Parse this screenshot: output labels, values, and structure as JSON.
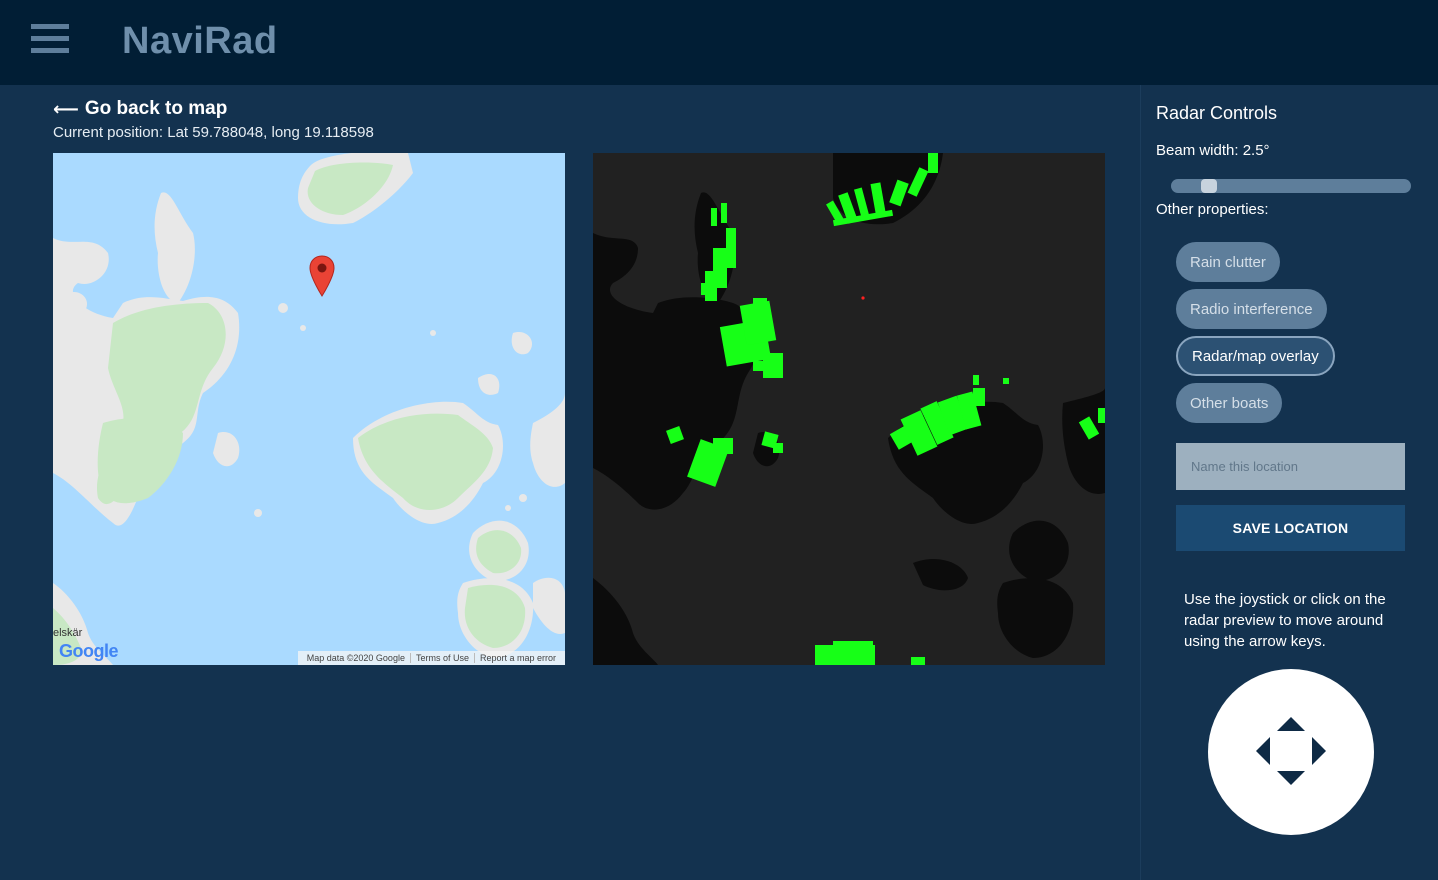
{
  "app": {
    "title": "NaviRad"
  },
  "header": {
    "menu_icon": "hamburger-menu-icon"
  },
  "main": {
    "back_arrow": "⟵",
    "back_label": "Go back to map",
    "position_text": "Current position: Lat 59.788048, long 19.118598",
    "map": {
      "place_label": "elskär",
      "google_logo": "Google",
      "credits": [
        "Map data ©2020 Google",
        "Terms of Use",
        "Report a map error"
      ],
      "marker_icon": "map-pin-icon"
    },
    "radar": {
      "marker_icon": "radar-center-dot"
    }
  },
  "sidebar": {
    "title": "Radar Controls",
    "beam_width": "Beam width: 2.5°",
    "beam_width_value_deg": 2.5,
    "other_properties": "Other properties:",
    "toggles": [
      {
        "label": "Rain clutter",
        "active": false
      },
      {
        "label": "Radio interference",
        "active": false
      },
      {
        "label": "Radar/map overlay",
        "active": true
      },
      {
        "label": "Other boats",
        "active": false
      }
    ],
    "location_placeholder": "Name this location",
    "save_label": "SAVE LOCATION",
    "hint": "Use the joystick or click on the radar preview to move around using the arrow keys.",
    "joystick_icon": "four-way-arrows-icon"
  },
  "colors": {
    "topbar": "#011e35",
    "background": "#13324f",
    "chip": "#5e7e9b",
    "chip_active": "#2c5173",
    "save_button": "#1b4a72",
    "water": "#aadaff",
    "land": "#e8e8e8",
    "park": "#c8e8c4",
    "radar_bg": "#212121",
    "radar_land": "#0c0c0c",
    "radar_echo": "#17ff17",
    "marker": "#ea4335"
  }
}
